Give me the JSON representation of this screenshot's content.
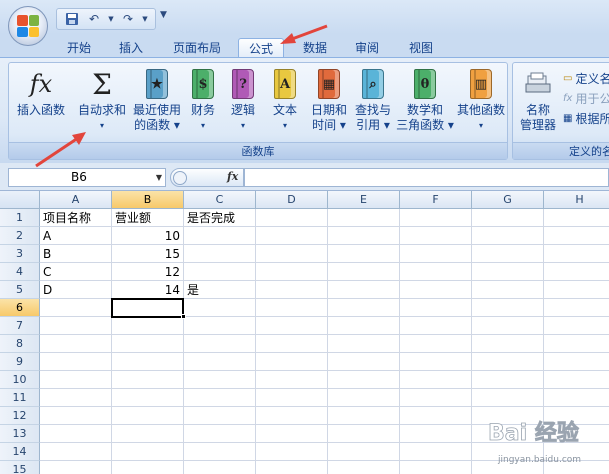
{
  "qat": {
    "dropdown_glyph": "▼"
  },
  "tabs": [
    {
      "label": "开始",
      "active": false
    },
    {
      "label": "插入",
      "active": false
    },
    {
      "label": "页面布局",
      "active": false
    },
    {
      "label": "公式",
      "active": true
    },
    {
      "label": "数据",
      "active": false
    },
    {
      "label": "审阅",
      "active": false
    },
    {
      "label": "视图",
      "active": false
    }
  ],
  "ribbon": {
    "function_library": {
      "group_label": "函数库",
      "buttons": [
        {
          "line1": "插入函数",
          "line2": "",
          "icon": "fx-icon"
        },
        {
          "line1": "自动求和",
          "line2": "▾",
          "icon": "sigma-icon"
        },
        {
          "line1": "最近使用",
          "line2": "的函数 ▾",
          "icon": "book-star-icon",
          "color": "#5aa0c8"
        },
        {
          "line1": "财务",
          "line2": "▾",
          "icon": "book-money-icon",
          "color": "#4caf6a"
        },
        {
          "line1": "逻辑",
          "line2": "▾",
          "icon": "book-question-icon",
          "color": "#b05ab6"
        },
        {
          "line1": "文本",
          "line2": "▾",
          "icon": "book-a-icon",
          "color": "#e8c840"
        },
        {
          "line1": "日期和",
          "line2": "时间 ▾",
          "icon": "book-calendar-icon",
          "color": "#e06a3c"
        },
        {
          "line1": "查找与",
          "line2": "引用 ▾",
          "icon": "book-magnifier-icon",
          "color": "#5ab4d8"
        },
        {
          "line1": "数学和",
          "line2": "三角函数 ▾",
          "icon": "book-theta-icon",
          "color": "#4caf6a"
        },
        {
          "line1": "其他函数",
          "line2": "▾",
          "icon": "book-stack-icon",
          "color": "#f0a040"
        }
      ]
    },
    "defined_names": {
      "group_label": "定义的名",
      "name_manager_line1": "名称",
      "name_manager_line2": "管理器",
      "items": [
        {
          "label": "定义名",
          "dim": false
        },
        {
          "label": "用于公",
          "dim": true
        },
        {
          "label": "根据所",
          "dim": false
        }
      ]
    }
  },
  "formula_bar": {
    "name_box": "B6",
    "fx": "fx",
    "formula": ""
  },
  "sheet": {
    "columns": [
      "A",
      "B",
      "C",
      "D",
      "E",
      "F",
      "G",
      "H"
    ],
    "selected_column": "B",
    "rows": [
      "1",
      "2",
      "3",
      "4",
      "5",
      "6",
      "7",
      "8",
      "9",
      "10",
      "11",
      "12",
      "13",
      "14",
      "15"
    ],
    "selected_row": "6",
    "cells": [
      {
        "col": "A",
        "row": 1,
        "value": "项目名称",
        "type": "text"
      },
      {
        "col": "B",
        "row": 1,
        "value": "营业额",
        "type": "text"
      },
      {
        "col": "C",
        "row": 1,
        "value": "是否完成",
        "type": "text"
      },
      {
        "col": "A",
        "row": 2,
        "value": "A",
        "type": "text"
      },
      {
        "col": "B",
        "row": 2,
        "value": "10",
        "type": "num"
      },
      {
        "col": "A",
        "row": 3,
        "value": "B",
        "type": "text"
      },
      {
        "col": "B",
        "row": 3,
        "value": "15",
        "type": "num"
      },
      {
        "col": "A",
        "row": 4,
        "value": "C",
        "type": "text"
      },
      {
        "col": "B",
        "row": 4,
        "value": "12",
        "type": "num"
      },
      {
        "col": "A",
        "row": 5,
        "value": "D",
        "type": "text"
      },
      {
        "col": "B",
        "row": 5,
        "value": "14",
        "type": "num"
      },
      {
        "col": "C",
        "row": 5,
        "value": "是",
        "type": "text"
      }
    ],
    "active_cell": "B6"
  },
  "colors": {
    "annotation_arrow": "#e2453c",
    "ribbon_text": "#15428b",
    "selected_header": "#f7c96a"
  },
  "watermark": {
    "text": "Bai 经验",
    "sub": "jingyan.baidu.com"
  }
}
